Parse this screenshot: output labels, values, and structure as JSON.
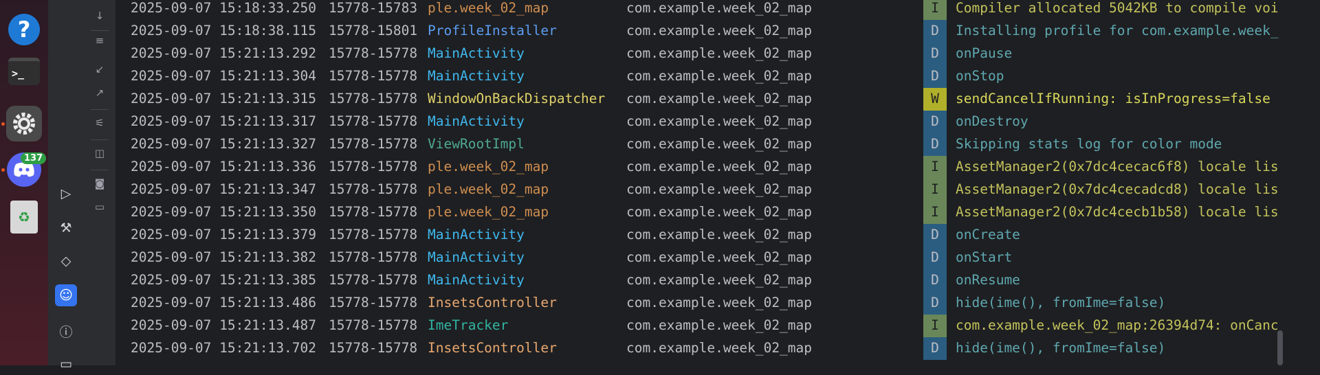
{
  "dock": {
    "help_glyph": "?",
    "terminal_glyph": ">_",
    "discord_badge": "137",
    "trash_glyph": "♻"
  },
  "colors": {
    "tag_orange": "#d39a52",
    "tag_blue": "#5aa4f5",
    "tag_cyan": "#4fc1ff",
    "tag_yellow": "#e3d46b",
    "tag_green": "#4fb29a",
    "tag_peach": "#e8a86a",
    "tag_teal": "#38b2a6"
  },
  "log_rows": [
    {
      "date": "2025-09-07 15:18:33.250",
      "pid": "15778-15783",
      "tag": "ple.week_02_map",
      "tag_color": "#cf8e50",
      "pkg": "com.example.week_02_map",
      "level": "I",
      "msg": "Compiler allocated 5042KB to compile voi"
    },
    {
      "date": "2025-09-07 15:18:38.115",
      "pid": "15778-15801",
      "tag": "ProfileInstaller",
      "tag_color": "#5c9cf0",
      "pkg": "com.example.week_02_map",
      "level": "D",
      "msg": "Installing profile for com.example.week_"
    },
    {
      "date": "2025-09-07 15:21:13.292",
      "pid": "15778-15778",
      "tag": "MainActivity",
      "tag_color": "#3fb9f0",
      "pkg": "com.example.week_02_map",
      "level": "D",
      "msg": "onPause"
    },
    {
      "date": "2025-09-07 15:21:13.304",
      "pid": "15778-15778",
      "tag": "MainActivity",
      "tag_color": "#3fb9f0",
      "pkg": "com.example.week_02_map",
      "level": "D",
      "msg": "onStop"
    },
    {
      "date": "2025-09-07 15:21:13.315",
      "pid": "15778-15778",
      "tag": "WindowOnBackDispatcher",
      "tag_color": "#e0d26a",
      "pkg": "com.example.week_02_map",
      "level": "W",
      "msg": "sendCancelIfRunning: isInProgress=false"
    },
    {
      "date": "2025-09-07 15:21:13.317",
      "pid": "15778-15778",
      "tag": "MainActivity",
      "tag_color": "#3fb9f0",
      "pkg": "com.example.week_02_map",
      "level": "D",
      "msg": "onDestroy"
    },
    {
      "date": "2025-09-07 15:21:13.327",
      "pid": "15778-15778",
      "tag": "ViewRootImpl",
      "tag_color": "#4fa995",
      "pkg": "com.example.week_02_map",
      "level": "D",
      "msg": "Skipping stats log for color mode"
    },
    {
      "date": "2025-09-07 15:21:13.336",
      "pid": "15778-15778",
      "tag": "ple.week_02_map",
      "tag_color": "#cf8e50",
      "pkg": "com.example.week_02_map",
      "level": "I",
      "msg": "AssetManager2(0x7dc4cecac6f8) locale lis"
    },
    {
      "date": "2025-09-07 15:21:13.347",
      "pid": "15778-15778",
      "tag": "ple.week_02_map",
      "tag_color": "#cf8e50",
      "pkg": "com.example.week_02_map",
      "level": "I",
      "msg": "AssetManager2(0x7dc4cecadcd8) locale lis"
    },
    {
      "date": "2025-09-07 15:21:13.350",
      "pid": "15778-15778",
      "tag": "ple.week_02_map",
      "tag_color": "#cf8e50",
      "pkg": "com.example.week_02_map",
      "level": "I",
      "msg": "AssetManager2(0x7dc4cecb1b58) locale lis"
    },
    {
      "date": "2025-09-07 15:21:13.379",
      "pid": "15778-15778",
      "tag": "MainActivity",
      "tag_color": "#3fb9f0",
      "pkg": "com.example.week_02_map",
      "level": "D",
      "msg": "onCreate"
    },
    {
      "date": "2025-09-07 15:21:13.382",
      "pid": "15778-15778",
      "tag": "MainActivity",
      "tag_color": "#3fb9f0",
      "pkg": "com.example.week_02_map",
      "level": "D",
      "msg": "onStart"
    },
    {
      "date": "2025-09-07 15:21:13.385",
      "pid": "15778-15778",
      "tag": "MainActivity",
      "tag_color": "#3fb9f0",
      "pkg": "com.example.week_02_map",
      "level": "D",
      "msg": "onResume"
    },
    {
      "date": "2025-09-07 15:21:13.486",
      "pid": "15778-15778",
      "tag": "InsetsController",
      "tag_color": "#e8a870",
      "pkg": "com.example.week_02_map",
      "level": "D",
      "msg": "hide(ime(), fromIme=false)"
    },
    {
      "date": "2025-09-07 15:21:13.487",
      "pid": "15778-15778",
      "tag": "ImeTracker",
      "tag_color": "#2fb5a0",
      "pkg": "com.example.week_02_map",
      "level": "I",
      "msg": "com.example.week_02_map:26394d74: onCanc"
    },
    {
      "date": "2025-09-07 15:21:13.702",
      "pid": "15778-15778",
      "tag": "InsetsController",
      "tag_color": "#e8a870",
      "pkg": "com.example.week_02_map",
      "level": "D",
      "msg": "hide(ime(), fromIme=false)"
    }
  ]
}
